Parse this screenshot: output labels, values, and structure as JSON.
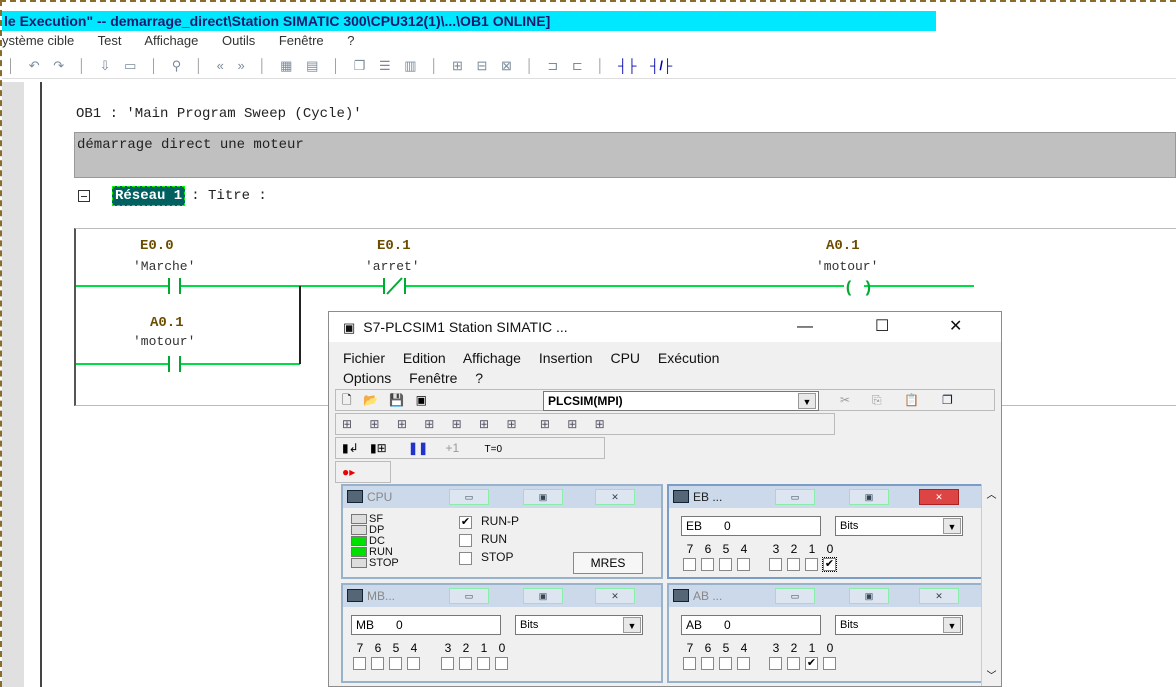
{
  "app": {
    "title": "le Execution\" -- demarrage_direct\\Station SIMATIC 300\\CPU312(1)\\...\\OB1  ONLINE]",
    "menu": [
      "ystème cible",
      "Test",
      "Affichage",
      "Outils",
      "Fenêtre",
      "?"
    ]
  },
  "editor": {
    "block_header": "OB1 :   'Main Program Sweep (Cycle)'",
    "comment": "démarrage direct une moteur",
    "network_label": "Réseau   1",
    "network_title": ": Titre :",
    "contacts": [
      {
        "address": "E0.0",
        "symbol": "'Marche'"
      },
      {
        "address": "E0.1",
        "symbol": "'arret'"
      },
      {
        "address": "A0.1",
        "symbol": "'motour'"
      },
      {
        "address": "A0.1",
        "symbol": "'motour'"
      }
    ],
    "coil_symbol": "( )"
  },
  "plcsim": {
    "title": "S7-PLCSIM1   Station SIMATIC ...",
    "menu": [
      "Fichier",
      "Edition",
      "Affichage",
      "Insertion",
      "CPU",
      "Exécution",
      "Options",
      "Fenêtre",
      "?"
    ],
    "connection": "PLCSIM(MPI)",
    "counter_label": "+1",
    "timer_reset": "T=0",
    "cpu": {
      "title": "CPU",
      "leds": [
        {
          "label": "SF",
          "on": false
        },
        {
          "label": "DP",
          "on": false
        },
        {
          "label": "DC",
          "on": true
        },
        {
          "label": "RUN",
          "on": true
        },
        {
          "label": "STOP",
          "on": false
        }
      ],
      "modes": [
        {
          "label": "RUN-P",
          "checked": true
        },
        {
          "label": "RUN",
          "checked": false
        },
        {
          "label": "STOP",
          "checked": false
        }
      ],
      "mres": "MRES"
    },
    "eb": {
      "title": "EB ...",
      "area": "EB",
      "index": "0",
      "format": "Bits",
      "bits": [
        "7",
        "6",
        "5",
        "4",
        "3",
        "2",
        "1",
        "0"
      ],
      "checked": [
        false,
        false,
        false,
        false,
        false,
        false,
        false,
        true
      ]
    },
    "mb": {
      "title": "MB...",
      "area": "MB",
      "index": "0",
      "format": "Bits",
      "bits": [
        "7",
        "6",
        "5",
        "4",
        "3",
        "2",
        "1",
        "0"
      ],
      "checked": [
        false,
        false,
        false,
        false,
        false,
        false,
        false,
        false
      ]
    },
    "ab": {
      "title": "AB ...",
      "area": "AB",
      "index": "0",
      "format": "Bits",
      "bits": [
        "7",
        "6",
        "5",
        "4",
        "3",
        "2",
        "1",
        "0"
      ],
      "checked": [
        false,
        false,
        false,
        false,
        false,
        false,
        true,
        false
      ]
    }
  }
}
